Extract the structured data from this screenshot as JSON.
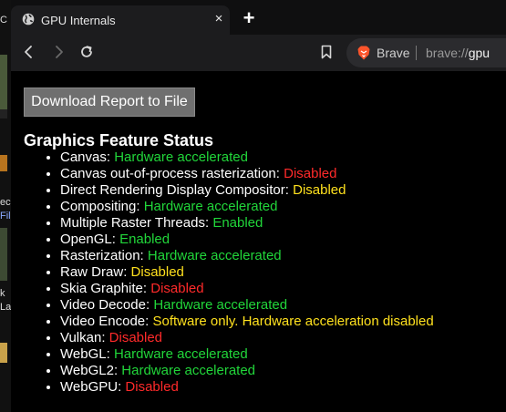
{
  "tab": {
    "title": "GPU Internals",
    "close_glyph": "×",
    "new_tab_glyph": "+"
  },
  "omnibox": {
    "brand": "Brave",
    "url_prefix": "brave://",
    "url_host": "gpu"
  },
  "page": {
    "download_button": "Download Report to File",
    "section_title": "Graphics Feature Status",
    "features": [
      {
        "name": "Canvas",
        "status": "Hardware accelerated",
        "color": "green"
      },
      {
        "name": "Canvas out-of-process rasterization",
        "status": "Disabled",
        "color": "red"
      },
      {
        "name": "Direct Rendering Display Compositor",
        "status": "Disabled",
        "color": "yellow"
      },
      {
        "name": "Compositing",
        "status": "Hardware accelerated",
        "color": "green"
      },
      {
        "name": "Multiple Raster Threads",
        "status": "Enabled",
        "color": "green"
      },
      {
        "name": "OpenGL",
        "status": "Enabled",
        "color": "green"
      },
      {
        "name": "Rasterization",
        "status": "Hardware accelerated",
        "color": "green"
      },
      {
        "name": "Raw Draw",
        "status": "Disabled",
        "color": "yellow"
      },
      {
        "name": "Skia Graphite",
        "status": "Disabled",
        "color": "red"
      },
      {
        "name": "Video Decode",
        "status": "Hardware accelerated",
        "color": "green"
      },
      {
        "name": "Video Encode",
        "status": "Software only. Hardware acceleration disabled",
        "color": "yellow"
      },
      {
        "name": "Vulkan",
        "status": "Disabled",
        "color": "red"
      },
      {
        "name": "WebGL",
        "status": "Hardware accelerated",
        "color": "green"
      },
      {
        "name": "WebGL2",
        "status": "Hardware accelerated",
        "color": "green"
      },
      {
        "name": "WebGPU",
        "status": "Disabled",
        "color": "red"
      }
    ]
  },
  "desktop_fragments": [
    "C",
    "ec",
    "Fil",
    "k",
    "La"
  ],
  "colors": {
    "green": "#21d63a",
    "red": "#ff2a2a",
    "yellow": "#ffe11e",
    "brave": "#fb542b"
  }
}
